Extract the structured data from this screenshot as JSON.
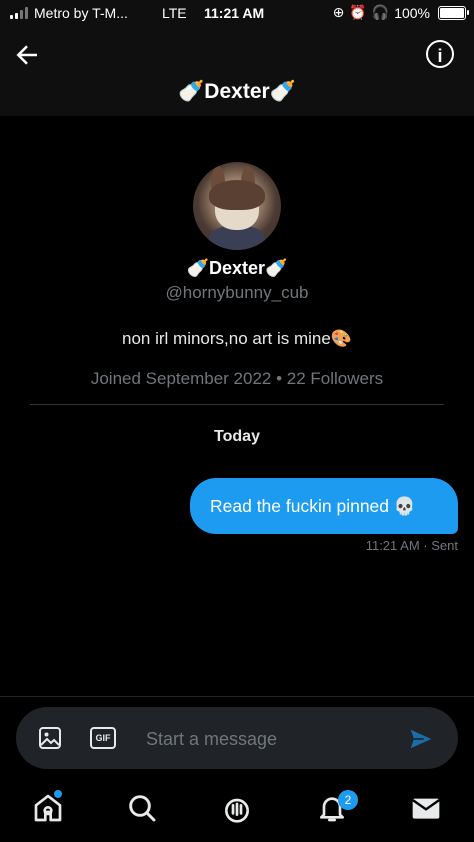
{
  "status_bar": {
    "carrier": "Metro by T-M...",
    "network": "LTE",
    "time": "11:21 AM",
    "battery": "100%"
  },
  "header": {
    "title": "🍼Dexter🍼"
  },
  "profile": {
    "name": "🍼Dexter🍼",
    "handle": "@hornybunny_cub",
    "bio": "non irl minors,no art is mine🎨",
    "joined": "Joined September 2022 • 22 Followers"
  },
  "conversation": {
    "day_label": "Today",
    "messages": [
      {
        "text": "Read the fuckin pinned 💀",
        "time": "11:21 AM",
        "status": "Sent"
      }
    ]
  },
  "composer": {
    "placeholder": "Start a message",
    "gif_label": "GIF"
  },
  "tab_bar": {
    "notifications_badge": "2"
  },
  "colors": {
    "accent": "#1d9bf0",
    "background": "#000000",
    "muted_text": "#71767b"
  }
}
